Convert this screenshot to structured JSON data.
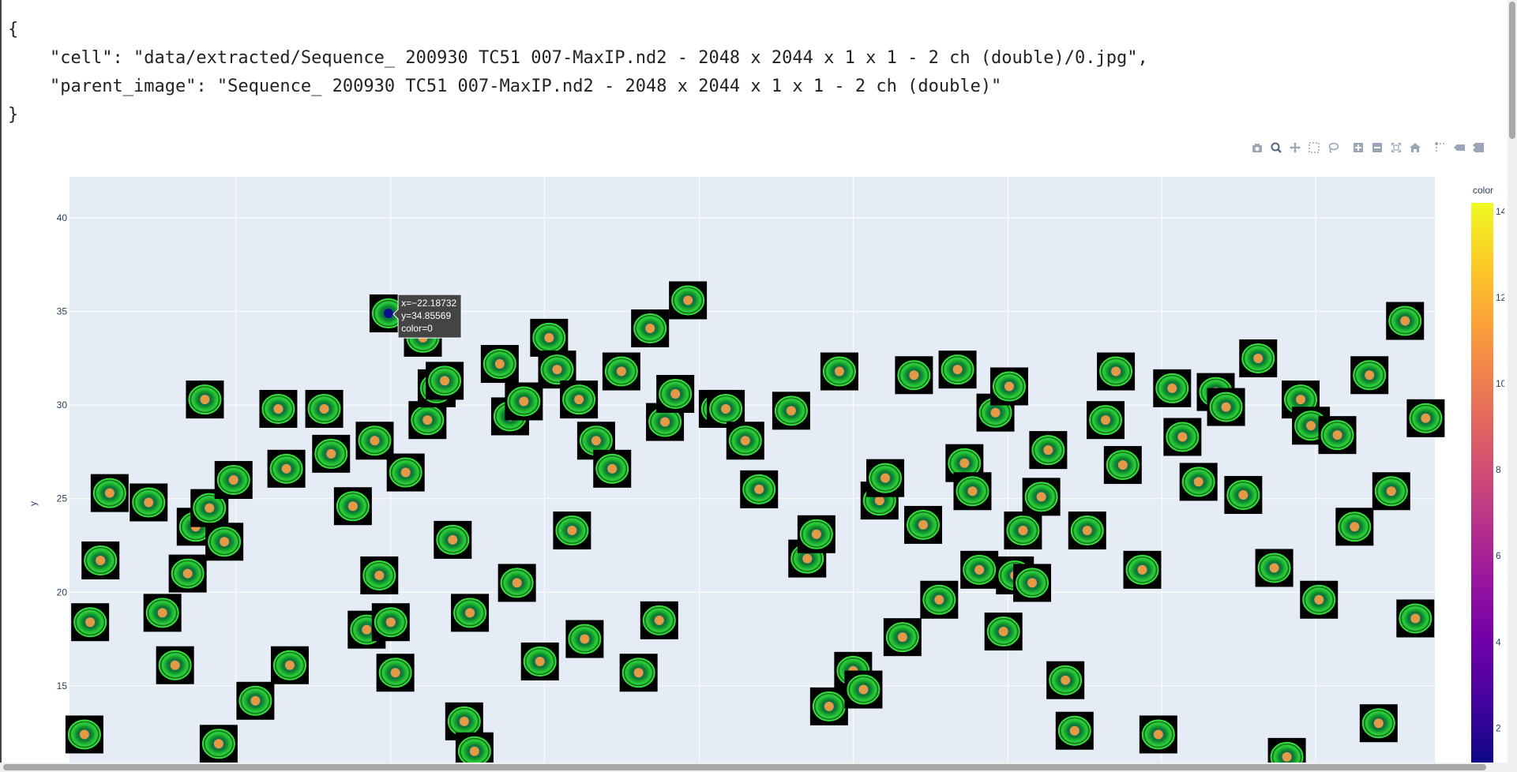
{
  "json_view": {
    "open": "{",
    "line1": "\"cell\": \"data/extracted/Sequence_ 200930 TC51 007-MaxIP.nd2 - 2048 x 2044 x 1 x 1 - 2 ch (double)/0.jpg\",",
    "line2": "\"parent_image\": \"Sequence_ 200930 TC51 007-MaxIP.nd2 - 2048 x 2044 x 1 x 1 - 2 ch (double)\"",
    "close": "}"
  },
  "modebar": [
    {
      "name": "download-plot-icon",
      "icon": "camera"
    },
    {
      "name": "zoom-icon",
      "icon": "magnifier",
      "active": true
    },
    {
      "name": "pan-icon",
      "icon": "cross-arrows"
    },
    {
      "name": "box-select-icon",
      "icon": "dashed-box"
    },
    {
      "name": "lasso-select-icon",
      "icon": "lasso"
    },
    {
      "name": "zoom-in-icon",
      "icon": "plus-box"
    },
    {
      "name": "zoom-out-icon",
      "icon": "minus-box"
    },
    {
      "name": "autoscale-icon",
      "icon": "expand"
    },
    {
      "name": "reset-axes-icon",
      "icon": "home"
    },
    {
      "name": "spike-lines-icon",
      "icon": "spikes"
    },
    {
      "name": "hover-closest-icon",
      "icon": "tag"
    },
    {
      "name": "hover-compare-icon",
      "icon": "tags"
    }
  ],
  "tooltip": {
    "x_text": "x=−22.18732",
    "y_text": "y=34.85569",
    "color_text": "color=0"
  },
  "chart_data": {
    "type": "scatter",
    "xlabel": "",
    "ylabel": "y",
    "ylim": [
      10.9,
      42.2
    ],
    "xlim": [
      -50,
      69
    ],
    "y_ticks": [
      15,
      20,
      25,
      30,
      35,
      40
    ],
    "x_gridlines": [
      -35.5,
      -22,
      -8.6,
      4.9,
      18.3,
      31.8,
      45.2,
      58.6
    ],
    "colorbar": {
      "title": "color",
      "ticks": [
        2,
        4,
        6,
        8,
        10,
        12,
        14
      ],
      "range": [
        1.2,
        14.2
      ]
    },
    "colorscale": [
      "#0d0887",
      "#46039f",
      "#7201a8",
      "#9c179e",
      "#bd3786",
      "#d8576b",
      "#ed7953",
      "#fb9f3a",
      "#fdca26",
      "#f0f921"
    ],
    "hover_point": {
      "x": -22.18732,
      "y": 34.85569,
      "color": 0
    },
    "points": [
      [
        -48.7,
        12.4,
        11
      ],
      [
        -47.3,
        21.7,
        11
      ],
      [
        -46.5,
        25.3,
        11
      ],
      [
        -48.2,
        18.4,
        11
      ],
      [
        -43.1,
        24.8,
        11
      ],
      [
        -41.9,
        18.9,
        11
      ],
      [
        -40.8,
        16.1,
        11
      ],
      [
        -39.7,
        21,
        11
      ],
      [
        -39,
        23.5,
        11
      ],
      [
        -38.2,
        30.3,
        11
      ],
      [
        -37.8,
        24.5,
        11
      ],
      [
        -37,
        11.9,
        11
      ],
      [
        -36.5,
        22.7,
        11
      ],
      [
        -35.7,
        26,
        11
      ],
      [
        -33.8,
        14.2,
        11
      ],
      [
        -31.8,
        29.8,
        11
      ],
      [
        -31.1,
        26.6,
        11
      ],
      [
        -30.8,
        16.1,
        11
      ],
      [
        -27.8,
        29.8,
        11
      ],
      [
        -27.2,
        27.4,
        11
      ],
      [
        -25.3,
        24.6,
        11
      ],
      [
        -24.1,
        18,
        11
      ],
      [
        -23.4,
        28.1,
        11
      ],
      [
        -23,
        20.9,
        11
      ],
      [
        -22.2,
        34.9,
        0
      ],
      [
        -22,
        18.4,
        11
      ],
      [
        -21.6,
        15.7,
        11
      ],
      [
        -20.7,
        26.4,
        11
      ],
      [
        -19.2,
        33.6,
        11
      ],
      [
        -18.8,
        29.2,
        11
      ],
      [
        -18,
        30.9,
        11
      ],
      [
        -17.3,
        31.3,
        11
      ],
      [
        -16.6,
        22.8,
        11
      ],
      [
        -15.1,
        18.9,
        11
      ],
      [
        -15.6,
        13.1,
        11
      ],
      [
        -14.7,
        11.5,
        11
      ],
      [
        -12.5,
        32.2,
        11
      ],
      [
        -11.6,
        29.4,
        11
      ],
      [
        -11,
        20.5,
        11
      ],
      [
        -10.4,
        30.2,
        11
      ],
      [
        -9,
        16.3,
        11
      ],
      [
        -8.2,
        33.6,
        11
      ],
      [
        -7.5,
        31.9,
        11
      ],
      [
        -6.2,
        23.3,
        11
      ],
      [
        -5.6,
        30.3,
        11
      ],
      [
        -5.1,
        17.5,
        11
      ],
      [
        -4.1,
        28.1,
        11
      ],
      [
        -2.7,
        26.6,
        11
      ],
      [
        -1.9,
        31.8,
        11
      ],
      [
        -0.4,
        15.7,
        11
      ],
      [
        0.6,
        34.1,
        11
      ],
      [
        1.4,
        18.5,
        11
      ],
      [
        1.9,
        29.1,
        11
      ],
      [
        2.8,
        30.6,
        11
      ],
      [
        3.9,
        35.6,
        11
      ],
      [
        6.5,
        29.8,
        11
      ],
      [
        7.2,
        29.8,
        11
      ],
      [
        8.9,
        28.1,
        11
      ],
      [
        10.1,
        25.5,
        11
      ],
      [
        12.9,
        29.7,
        11
      ],
      [
        14.3,
        21.8,
        11
      ],
      [
        15.1,
        23.1,
        11
      ],
      [
        16.2,
        13.9,
        11
      ],
      [
        17.1,
        31.8,
        11
      ],
      [
        18.3,
        15.8,
        11
      ],
      [
        19.2,
        14.8,
        11
      ],
      [
        20.6,
        24.9,
        11
      ],
      [
        21.1,
        26.1,
        11
      ],
      [
        22.6,
        17.6,
        11
      ],
      [
        23.6,
        31.6,
        11
      ],
      [
        24.4,
        23.6,
        11
      ],
      [
        25.8,
        19.6,
        11
      ],
      [
        27.4,
        31.9,
        11
      ],
      [
        28,
        26.9,
        11
      ],
      [
        28.7,
        25.4,
        11
      ],
      [
        29.3,
        21.2,
        11
      ],
      [
        30.7,
        29.6,
        11
      ],
      [
        31.4,
        17.9,
        11
      ],
      [
        31.9,
        31,
        11
      ],
      [
        32.4,
        20.9,
        11
      ],
      [
        33.1,
        23.3,
        11
      ],
      [
        33.9,
        20.5,
        11
      ],
      [
        34.7,
        25.1,
        11
      ],
      [
        35.3,
        27.6,
        11
      ],
      [
        36.8,
        15.3,
        11
      ],
      [
        37.6,
        12.6,
        11
      ],
      [
        38.7,
        23.3,
        11
      ],
      [
        40.3,
        29.2,
        11
      ],
      [
        41.2,
        31.8,
        11
      ],
      [
        41.8,
        26.8,
        11
      ],
      [
        43.5,
        21.2,
        11
      ],
      [
        44.9,
        12.4,
        11
      ],
      [
        46.1,
        30.9,
        11
      ],
      [
        47,
        28.3,
        11
      ],
      [
        48.4,
        25.9,
        11
      ],
      [
        49.9,
        30.7,
        11
      ],
      [
        50.8,
        29.9,
        11
      ],
      [
        52.3,
        25.2,
        11
      ],
      [
        53.6,
        32.5,
        11
      ],
      [
        55,
        21.3,
        11
      ],
      [
        56.1,
        11.2,
        11
      ],
      [
        57.3,
        30.3,
        11
      ],
      [
        58.2,
        28.9,
        11
      ],
      [
        58.9,
        19.6,
        11
      ],
      [
        60.5,
        28.4,
        11
      ],
      [
        62,
        23.5,
        11
      ],
      [
        63.3,
        31.6,
        11
      ],
      [
        64.1,
        13,
        11
      ],
      [
        65.2,
        25.4,
        11
      ],
      [
        66.4,
        34.5,
        11
      ],
      [
        67.3,
        18.6,
        11
      ],
      [
        68.2,
        29.3,
        11
      ]
    ]
  }
}
